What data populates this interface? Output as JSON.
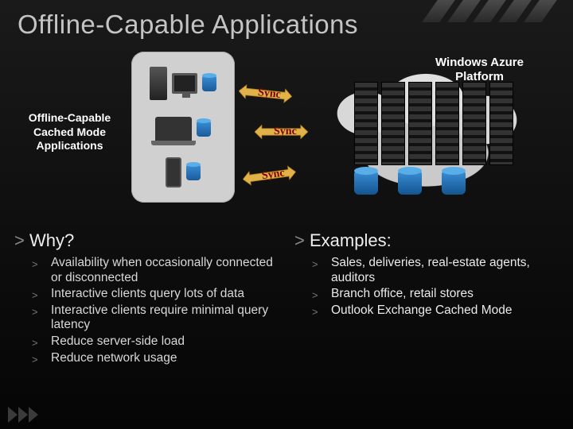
{
  "title": "Offline-Capable Applications",
  "diagram": {
    "leftLabel": "Offline-Capable Cached Mode Applications",
    "rightLabel": "Windows Azure Platform",
    "sync1": "Sync",
    "sync2": "Sync",
    "sync3": "Sync"
  },
  "columns": {
    "why": {
      "heading": "Why?",
      "items": [
        "Availability when occasionally connected or disconnected",
        "Interactive clients query lots of data",
        "Interactive clients require minimal query latency",
        "Reduce server-side load",
        "Reduce network usage"
      ]
    },
    "examples": {
      "heading": "Examples:",
      "items": [
        "Sales, deliveries, real-estate agents, auditors",
        "Branch office, retail stores",
        "Outlook Exchange Cached Mode"
      ]
    }
  }
}
